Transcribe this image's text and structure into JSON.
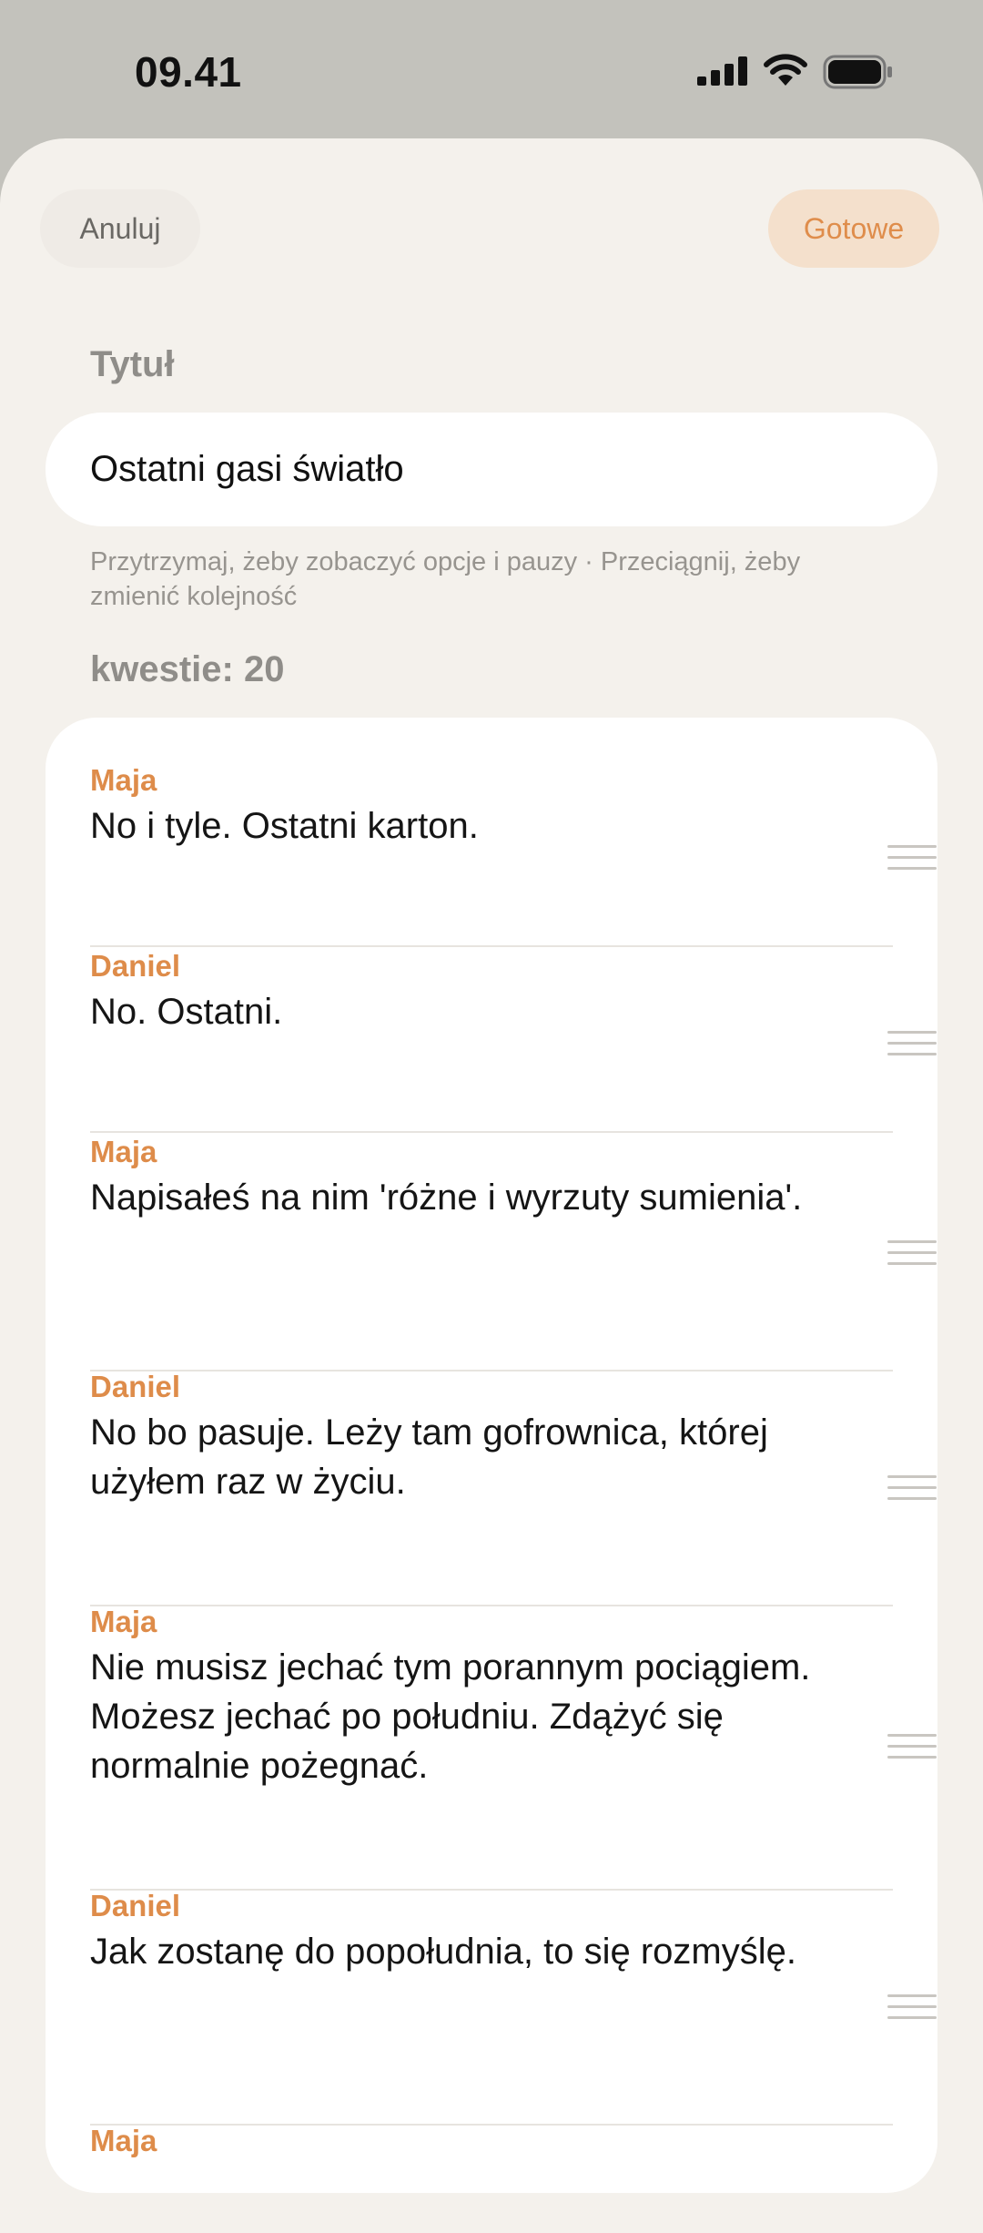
{
  "status_bar": {
    "time": "09.41"
  },
  "header": {
    "cancel_label": "Anuluj",
    "done_label": "Gotowe"
  },
  "title_section": {
    "label": "Tytuł",
    "value": "Ostatni gasi światło"
  },
  "hint": "Przytrzymaj, żeby zobaczyć opcje i pauzy · Przeciągnij, żeby zmienić kolejność",
  "lines_section": {
    "count_label": "kwestie: 20"
  },
  "lines": [
    {
      "speaker": "Maja",
      "text": "No i tyle. Ostatni karton."
    },
    {
      "speaker": "Daniel",
      "text": "No. Ostatni."
    },
    {
      "speaker": "Maja",
      "text": "Napisałeś na nim 'różne i wyrzuty sumienia'."
    },
    {
      "speaker": "Daniel",
      "text": "No bo pasuje. Leży tam gofrownica, której użyłem raz w życiu."
    },
    {
      "speaker": "Maja",
      "text": "Nie musisz jechać tym porannym pociągiem. Możesz jechać po południu. Zdążyć się normalnie pożegnać."
    },
    {
      "speaker": "Daniel",
      "text": "Jak zostanę do popołudnia, to się rozmyślę."
    },
    {
      "speaker": "Maja",
      "text": ""
    }
  ],
  "colors": {
    "accent": "#de8c4a",
    "sheet_bg": "#f4f1ec",
    "status_bg": "#c3c2bc"
  }
}
